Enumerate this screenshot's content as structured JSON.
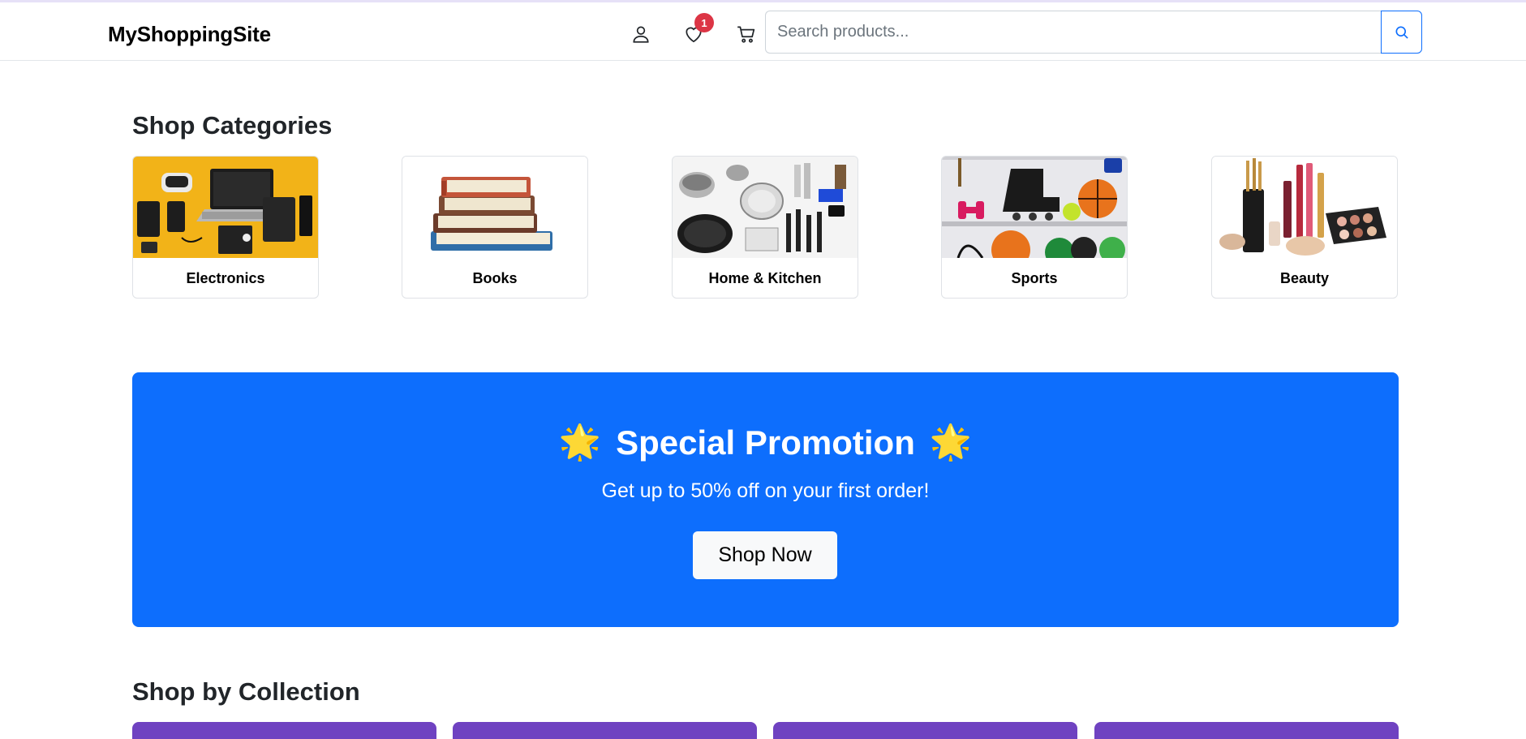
{
  "header": {
    "brand": "MyShoppingSite",
    "wishlist_count": "1",
    "search_placeholder": "Search products..."
  },
  "categories": {
    "title": "Shop Categories",
    "items": [
      {
        "label": "Electronics",
        "icon": "electronics-image"
      },
      {
        "label": "Books",
        "icon": "books-image"
      },
      {
        "label": "Home & Kitchen",
        "icon": "kitchen-image"
      },
      {
        "label": "Sports",
        "icon": "sports-image"
      },
      {
        "label": "Beauty",
        "icon": "beauty-image"
      }
    ]
  },
  "promo": {
    "emoji": "🌟",
    "title": "Special Promotion",
    "subtitle": "Get up to 50% off on your first order!",
    "button": "Shop Now",
    "color": "#0d6efd"
  },
  "collections": {
    "title": "Shop by Collection",
    "color": "#6f42c1"
  },
  "colors": {
    "badge": "#dc3545",
    "accent": "#0d6efd"
  }
}
